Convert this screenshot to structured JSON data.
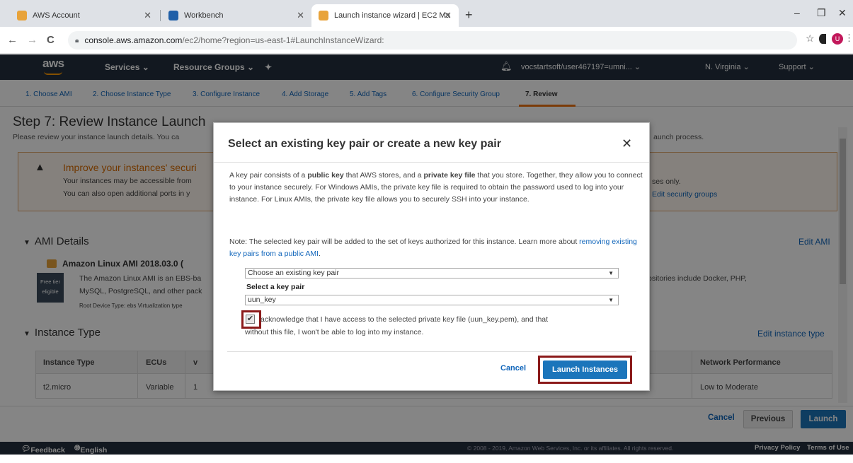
{
  "browser": {
    "tabs": [
      {
        "title": "AWS Account",
        "favicon_color": "#e8a33a"
      },
      {
        "title": "Workbench",
        "favicon_color": "#1f5fa8"
      },
      {
        "title": "Launch instance wizard | EC2 Ma",
        "favicon_color": "#e8a33a"
      }
    ],
    "new_tab": "+",
    "window_controls": [
      "–",
      "❐",
      "✕"
    ],
    "nav": {
      "back": "←",
      "forward": "→",
      "reload": "C"
    },
    "url_host": "console.aws.amazon.com",
    "url_path": "/ec2/home?region=us-east-1#LaunchInstanceWizard:",
    "profile_initial": "U"
  },
  "aws_nav": {
    "logo": "aws",
    "services": "Services ⌄",
    "resource_groups": "Resource Groups ⌄",
    "pin": "✦",
    "account": "vocstartsoft/user467197=umni... ⌄",
    "region": "N. Virginia ⌄",
    "support": "Support ⌄"
  },
  "steps": [
    "1. Choose AMI",
    "2. Choose Instance Type",
    "3. Configure Instance",
    "4. Add Storage",
    "5. Add Tags",
    "6. Configure Security Group",
    "7. Review"
  ],
  "page": {
    "title": "Step 7: Review Instance Launch",
    "subtitle_left": "Please review your instance launch details. You ca",
    "subtitle_right": "aunch process.",
    "warning": {
      "title": "Improve your instances' securi",
      "line1": "Your instances may be accessible from",
      "line2": "You can also open additional ports in y",
      "right1": "ses only.",
      "right2": "Edit security groups"
    },
    "ami_section": "AMI Details",
    "edit_ami": "Edit AMI",
    "ami_title": "Amazon Linux AMI 2018.03.0 (",
    "free_tier": "Free tier eligible",
    "ami_desc1": "The Amazon Linux AMI is an EBS-ba",
    "ami_desc2": "MySQL, PostgreSQL, and other pack",
    "ami_desc3": "Root Device Type: ebs    Virtualization type",
    "ami_right": "ositories include Docker, PHP,",
    "instance_section": "Instance Type",
    "edit_instance": "Edit instance type",
    "table_headers": [
      "Instance Type",
      "ECUs",
      "v",
      "Network Performance"
    ],
    "table_row": [
      "t2.micro",
      "Variable",
      "1",
      "Low to Moderate"
    ],
    "cancel": "Cancel",
    "previous": "Previous",
    "launch": "Launch"
  },
  "footer": {
    "feedback": "Feedback",
    "language": "English (US)",
    "copyright": "© 2008 - 2019, Amazon Web Services, Inc. or its affiliates. All rights reserved.",
    "privacy": "Privacy Policy",
    "terms": "Terms of Use"
  },
  "modal": {
    "title": "Select an existing key pair or create a new key pair",
    "close": "✕",
    "para1_a": "A key pair consists of a ",
    "para1_b": "public key",
    "para1_c": " that AWS stores, and a ",
    "para1_d": "private key file",
    "para1_e": " that you store. Together, they allow you to connect to your instance securely. For Windows AMIs, the private key file is required to obtain the password used to log into your instance. For Linux AMIs, the private key file allows you to securely SSH into your instance.",
    "note_a": "Note: The selected key pair will be added to the set of keys authorized for this instance. Learn more about ",
    "note_link": "removing existing key pairs from a public AMI",
    "note_b": ".",
    "key_option": "Choose an existing key pair",
    "select_label": "Select a key pair",
    "key_value": "uun_key",
    "ack_line1": "acknowledge that I have access to the selected private key file (uun_key.pem), and that",
    "ack_line2": "without this file, I won't be able to log into my instance.",
    "checkbox_checked": true,
    "cancel": "Cancel",
    "launch": "Launch Instances"
  }
}
